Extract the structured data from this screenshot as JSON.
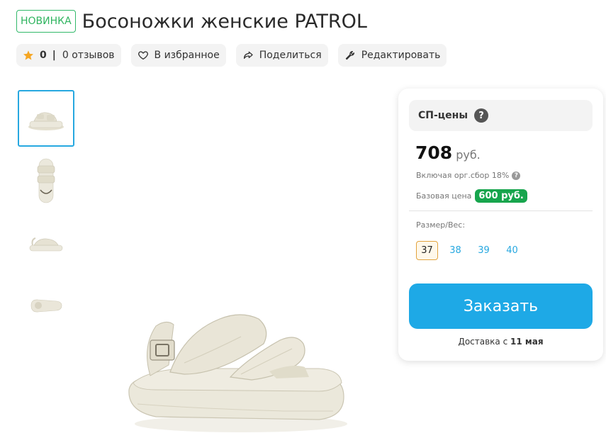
{
  "product": {
    "badge": "НОВИНКА",
    "title": "Босоножки женские PATROL"
  },
  "actions": {
    "rating": "0",
    "separator": "|",
    "reviews": "0 отзывов",
    "favorite": "В избранное",
    "share": "Поделиться",
    "edit": "Редактировать"
  },
  "gallery": {
    "thumbnail_count": 4,
    "active_index": 0
  },
  "price_card": {
    "header": "СП-цены",
    "help": "?",
    "price": "708",
    "currency": "руб.",
    "fee_note": "Включая орг.сбор 18%",
    "base_label": "Базовая цена",
    "base_price": "600 руб.",
    "size_label": "Размер/Вес:",
    "sizes": [
      "37",
      "38",
      "39",
      "40"
    ],
    "selected_size": "37",
    "order_button": "Заказать",
    "delivery_prefix": "Доставка с",
    "delivery_date": "11 мая"
  },
  "colors": {
    "accent": "#1ea9e6",
    "badge_green": "#17a54d",
    "new_badge": "#32b96a",
    "star": "#f5a623"
  },
  "icons": {
    "rating": "star-icon",
    "favorite": "heart-icon",
    "share": "share-arrow-icon",
    "edit": "wrench-icon"
  }
}
